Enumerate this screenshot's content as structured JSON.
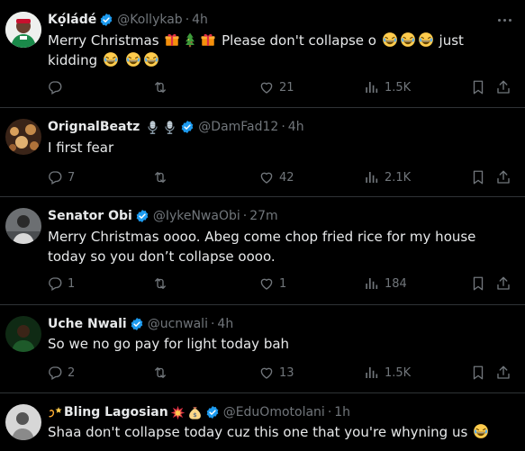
{
  "tweets": [
    {
      "name": "Kọ́ládé",
      "handle": "@Kollykab",
      "time": "4h",
      "text_a": "Merry Christmas",
      "text_b": "Please don't collapse o",
      "text_c": "just kidding",
      "reply_count": "",
      "retweet_count": "",
      "like_count": "21",
      "view_count": "1.5K"
    },
    {
      "name": "OrignalBeatz",
      "handle": "@DamFad12",
      "time": "4h",
      "text": "I first fear",
      "reply_count": "7",
      "retweet_count": "",
      "like_count": "42",
      "view_count": "2.1K"
    },
    {
      "name": "Senator Obi",
      "handle": "@IykeNwaObi",
      "time": "27m",
      "text": "Merry Christmas oooo. Abeg come chop fried rice for my house today so you don’t collapse oooo.",
      "reply_count": "1",
      "retweet_count": "",
      "like_count": "1",
      "view_count": "184"
    },
    {
      "name": "Uche Nwali",
      "handle": "@ucnwali",
      "time": "4h",
      "text": "So we no go pay for light today bah",
      "reply_count": "2",
      "retweet_count": "",
      "like_count": "13",
      "view_count": "1.5K"
    },
    {
      "name": "Bling Lagosian",
      "handle": "@EduOmotolani",
      "time": "1h",
      "text": "Shaa don't collapse today cuz this one that you're whyning us"
    }
  ],
  "colors": {
    "background": "#000000",
    "text": "#e7e9ea",
    "muted": "#71767b",
    "verified": "#1d9bf0",
    "border": "#2f3336"
  }
}
